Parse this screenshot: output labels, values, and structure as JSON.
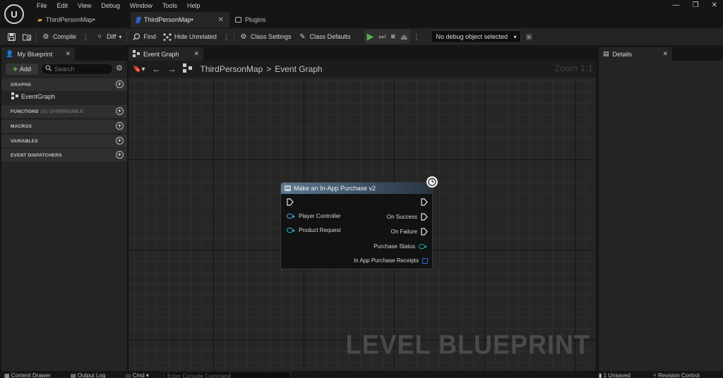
{
  "app": {
    "logo_text": "U",
    "menu": [
      "File",
      "Edit",
      "View",
      "Debug",
      "Window",
      "Tools",
      "Help"
    ],
    "tabs": [
      {
        "label": "ThirdPersonMap•",
        "active": false
      },
      {
        "label": "ThirdPersonMap•",
        "active": true
      },
      {
        "label": "Plugins",
        "active": false
      }
    ],
    "window_controls": {
      "minimize": "—",
      "restore": "❐",
      "close": "✕"
    }
  },
  "toolbar": {
    "compile": "Compile",
    "diff": "Diff",
    "find": "Find",
    "hide_unrelated": "Hide Unrelated",
    "class_settings": "Class Settings",
    "class_defaults": "Class Defaults",
    "debug_object": "No debug object selected"
  },
  "left_panel": {
    "tab_label": "My Blueprint",
    "add_label": "Add",
    "search_placeholder": "Search",
    "sections": {
      "graphs": "GRAPHS",
      "functions": "FUNCTIONS",
      "functions_sub": "(21 OVERRIDABLE",
      "macros": "MACROS",
      "variables": "VARIABLES",
      "event_dispatchers": "EVENT DISPATCHERS"
    },
    "graph_items": [
      "EventGraph"
    ]
  },
  "graph": {
    "tab_label": "Event Graph",
    "breadcrumb_root": "ThirdPersonMap",
    "breadcrumb_separator": ">",
    "breadcrumb_leaf": "Event Graph",
    "zoom": "Zoom 1:1",
    "watermark": "LEVEL BLUEPRINT",
    "node": {
      "title": "Make an In-App Purchase v2",
      "inputs": [
        "Player Controller",
        "Product Request"
      ],
      "outputs": [
        "On Success",
        "On Failure",
        "Purchase Status",
        "In App Purchase Receipts"
      ],
      "colors": {
        "header": "#5e7a92",
        "object_pin": "#2fa9e0",
        "enum_pin": "#19a79a",
        "struct_pin": "#2f6fd8"
      }
    }
  },
  "right_panel": {
    "tab_label": "Details"
  },
  "statusbar": {
    "content_drawer": "Content Drawer",
    "output_log": "Output Log",
    "cmd": "Cmd",
    "console_placeholder": "Enter Console Command",
    "unsaved": "1 Unsaved",
    "revision_control": "Revision Control"
  }
}
